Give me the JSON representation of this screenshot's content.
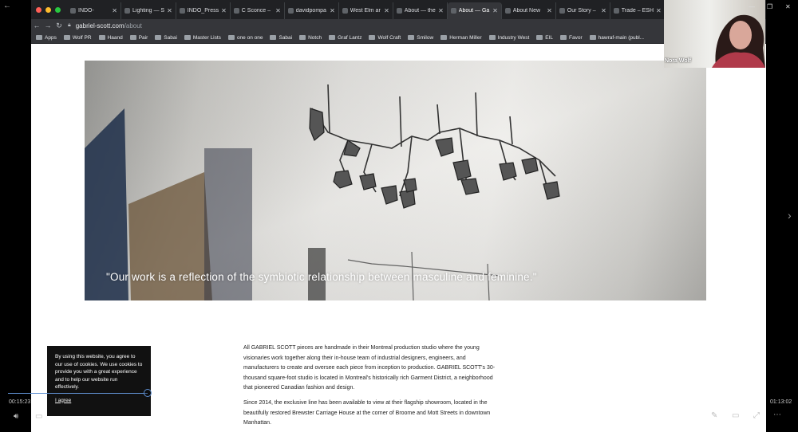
{
  "tabs": [
    {
      "label": "INDO-",
      "active": false
    },
    {
      "label": "Lighting — S",
      "active": false
    },
    {
      "label": "INDO_Press",
      "active": false
    },
    {
      "label": "C Sconce –",
      "active": false
    },
    {
      "label": "davidpompa",
      "active": false
    },
    {
      "label": "West Elm ar",
      "active": false
    },
    {
      "label": "About — the",
      "active": false
    },
    {
      "label": "About — Ga",
      "active": true
    },
    {
      "label": "About New",
      "active": false
    },
    {
      "label": "Our Story –",
      "active": false
    },
    {
      "label": "Trade – ESH",
      "active": false
    }
  ],
  "url": {
    "domain": "gabriel-scott.com",
    "path": "/about"
  },
  "bookmarks": [
    "Apps",
    "Wolf PR",
    "Haand",
    "Pair",
    "Sabai",
    "Master Lists",
    "one on one",
    "Sabai",
    "Notch",
    "Graf Lantz",
    "Wolf Craft",
    "Smilow",
    "Herman Miller",
    "Industry West",
    "EIL",
    "Favor",
    "hawraf-main (publ..."
  ],
  "hero": {
    "quote": "\"Our work is a reflection of the symbiotic relationship between masculine and feminine.\""
  },
  "body": {
    "para1": "All GABRIEL SCOTT pieces are handmade in their Montreal production studio where the young visionaries work together along their in-house team of industrial designers, engineers, and manufacturers to create and oversee each piece from inception to production. GABRIEL SCOTT's 30-thousand square-foot studio is located in Montreal's historically rich Garment District, a neighborhood that pioneered Canadian fashion and design.",
    "para2": "Since 2014, the exclusive line has been available to view at their flagship showroom, located in the beautifully restored Brewster Carriage House at the corner of Broome and Mott Streets in downtown Manhattan."
  },
  "cookie": {
    "text": "By using this website, you agree to our use of cookies. We use cookies to provide you with a great experience and to help our website run effectively.",
    "agree": "I agree"
  },
  "webcam": {
    "name": "Nora Wolf"
  },
  "player": {
    "elapsed": "00:15:23",
    "total": "01:13:02",
    "progress": 0.184
  },
  "colors": {
    "tab_bg": "#202124",
    "toolbar_bg": "#35363a",
    "scrub_accent": "#5f8fd0"
  }
}
